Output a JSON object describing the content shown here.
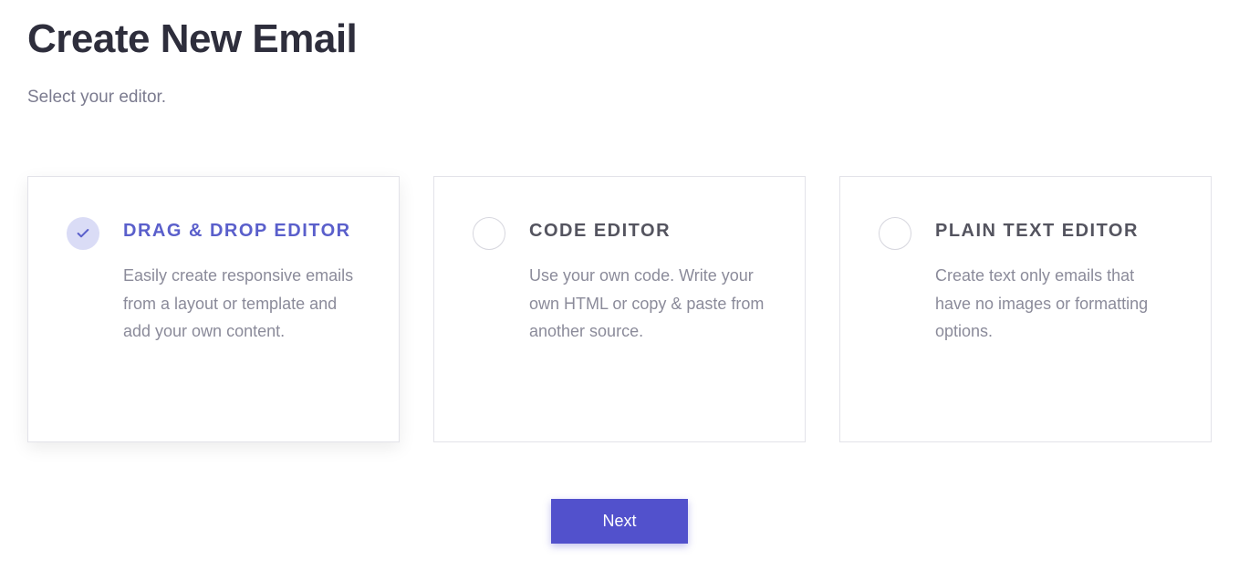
{
  "header": {
    "title": "Create New Email",
    "subtitle": "Select your editor."
  },
  "options": [
    {
      "selected": true,
      "title": "DRAG & DROP EDITOR",
      "description": "Easily create responsive emails from a layout or template and add your own content."
    },
    {
      "selected": false,
      "title": "CODE EDITOR",
      "description": "Use your own code. Write your own HTML or copy & paste from another source."
    },
    {
      "selected": false,
      "title": "PLAIN TEXT EDITOR",
      "description": "Create text only emails that have no images or formatting options."
    }
  ],
  "actions": {
    "next_label": "Next"
  }
}
